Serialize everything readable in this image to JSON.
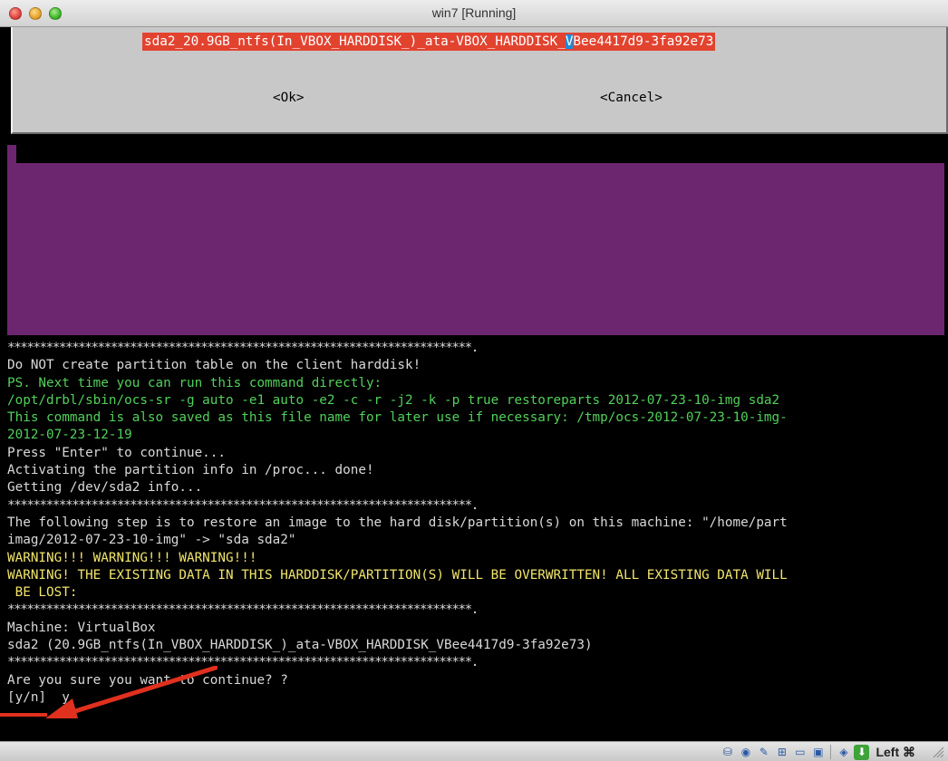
{
  "window": {
    "title": "win7 [Running]"
  },
  "dialog": {
    "selected_item_before_cursor": "sda2_20.9GB_ntfs(In_VBOX_HARDDISK_)_ata-VBOX_HARDDISK_",
    "selected_item_cursor_char": "V",
    "selected_item_after_cursor": "Bee4417d9-3fa92e73",
    "ok_label": "<Ok>",
    "cancel_label": "<Cancel>"
  },
  "terminal": {
    "lines": [
      {
        "text": "************************************************************************.",
        "color": "stars"
      },
      {
        "text": "Do NOT create partition table on the client harddisk!",
        "color": "white"
      },
      {
        "text": "PS. Next time you can run this command directly:",
        "color": "green"
      },
      {
        "text": "/opt/drbl/sbin/ocs-sr -g auto -e1 auto -e2 -c -r -j2 -k -p true restoreparts 2012-07-23-10-img sda2",
        "color": "green"
      },
      {
        "text": "This command is also saved as this file name for later use if necessary: /tmp/ocs-2012-07-23-10-img-",
        "color": "green"
      },
      {
        "text": "2012-07-23-12-19",
        "color": "green"
      },
      {
        "text": "Press \"Enter\" to continue...",
        "color": "white"
      },
      {
        "text": "Activating the partition info in /proc... done!",
        "color": "white"
      },
      {
        "text": "Getting /dev/sda2 info...",
        "color": "white"
      },
      {
        "text": "************************************************************************.",
        "color": "stars"
      },
      {
        "text": "The following step is to restore an image to the hard disk/partition(s) on this machine: \"/home/part",
        "color": "white"
      },
      {
        "text": "imag/2012-07-23-10-img\" -> \"sda sda2\"",
        "color": "white"
      },
      {
        "text": "WARNING!!! WARNING!!! WARNING!!!",
        "color": "yellow"
      },
      {
        "text": "WARNING! THE EXISTING DATA IN THIS HARDDISK/PARTITION(S) WILL BE OVERWRITTEN! ALL EXISTING DATA WILL",
        "color": "yellow"
      },
      {
        "text": " BE LOST:",
        "color": "yellow"
      },
      {
        "text": "************************************************************************.",
        "color": "stars"
      },
      {
        "text": "Machine: VirtualBox",
        "color": "white"
      },
      {
        "text": "sda2 (20.9GB_ntfs(In_VBOX_HARDDISK_)_ata-VBOX_HARDDISK_VBee4417d9-3fa92e73)",
        "color": "white"
      },
      {
        "text": "************************************************************************.",
        "color": "stars"
      },
      {
        "text": "Are you sure you want to continue? ?",
        "color": "white"
      },
      {
        "text": "[y/n]  y",
        "color": "white"
      }
    ]
  },
  "statusbar": {
    "icons": [
      "harddisk-icon",
      "cd-icon",
      "pencil-icon",
      "network-icon",
      "usb-icon",
      "shared-folder-icon",
      "vt-x-icon",
      "mouse-integration-icon"
    ],
    "host_key": "Left ⌘"
  },
  "colors": {
    "dialog_bg": "#c8c8c8",
    "selection_bg": "#e2432f",
    "purple_bg": "#6c2670",
    "term_green": "#52d05a",
    "term_yellow": "#f1e56b",
    "term_white": "#d9d9d9",
    "annotation_red": "#e0301e"
  }
}
